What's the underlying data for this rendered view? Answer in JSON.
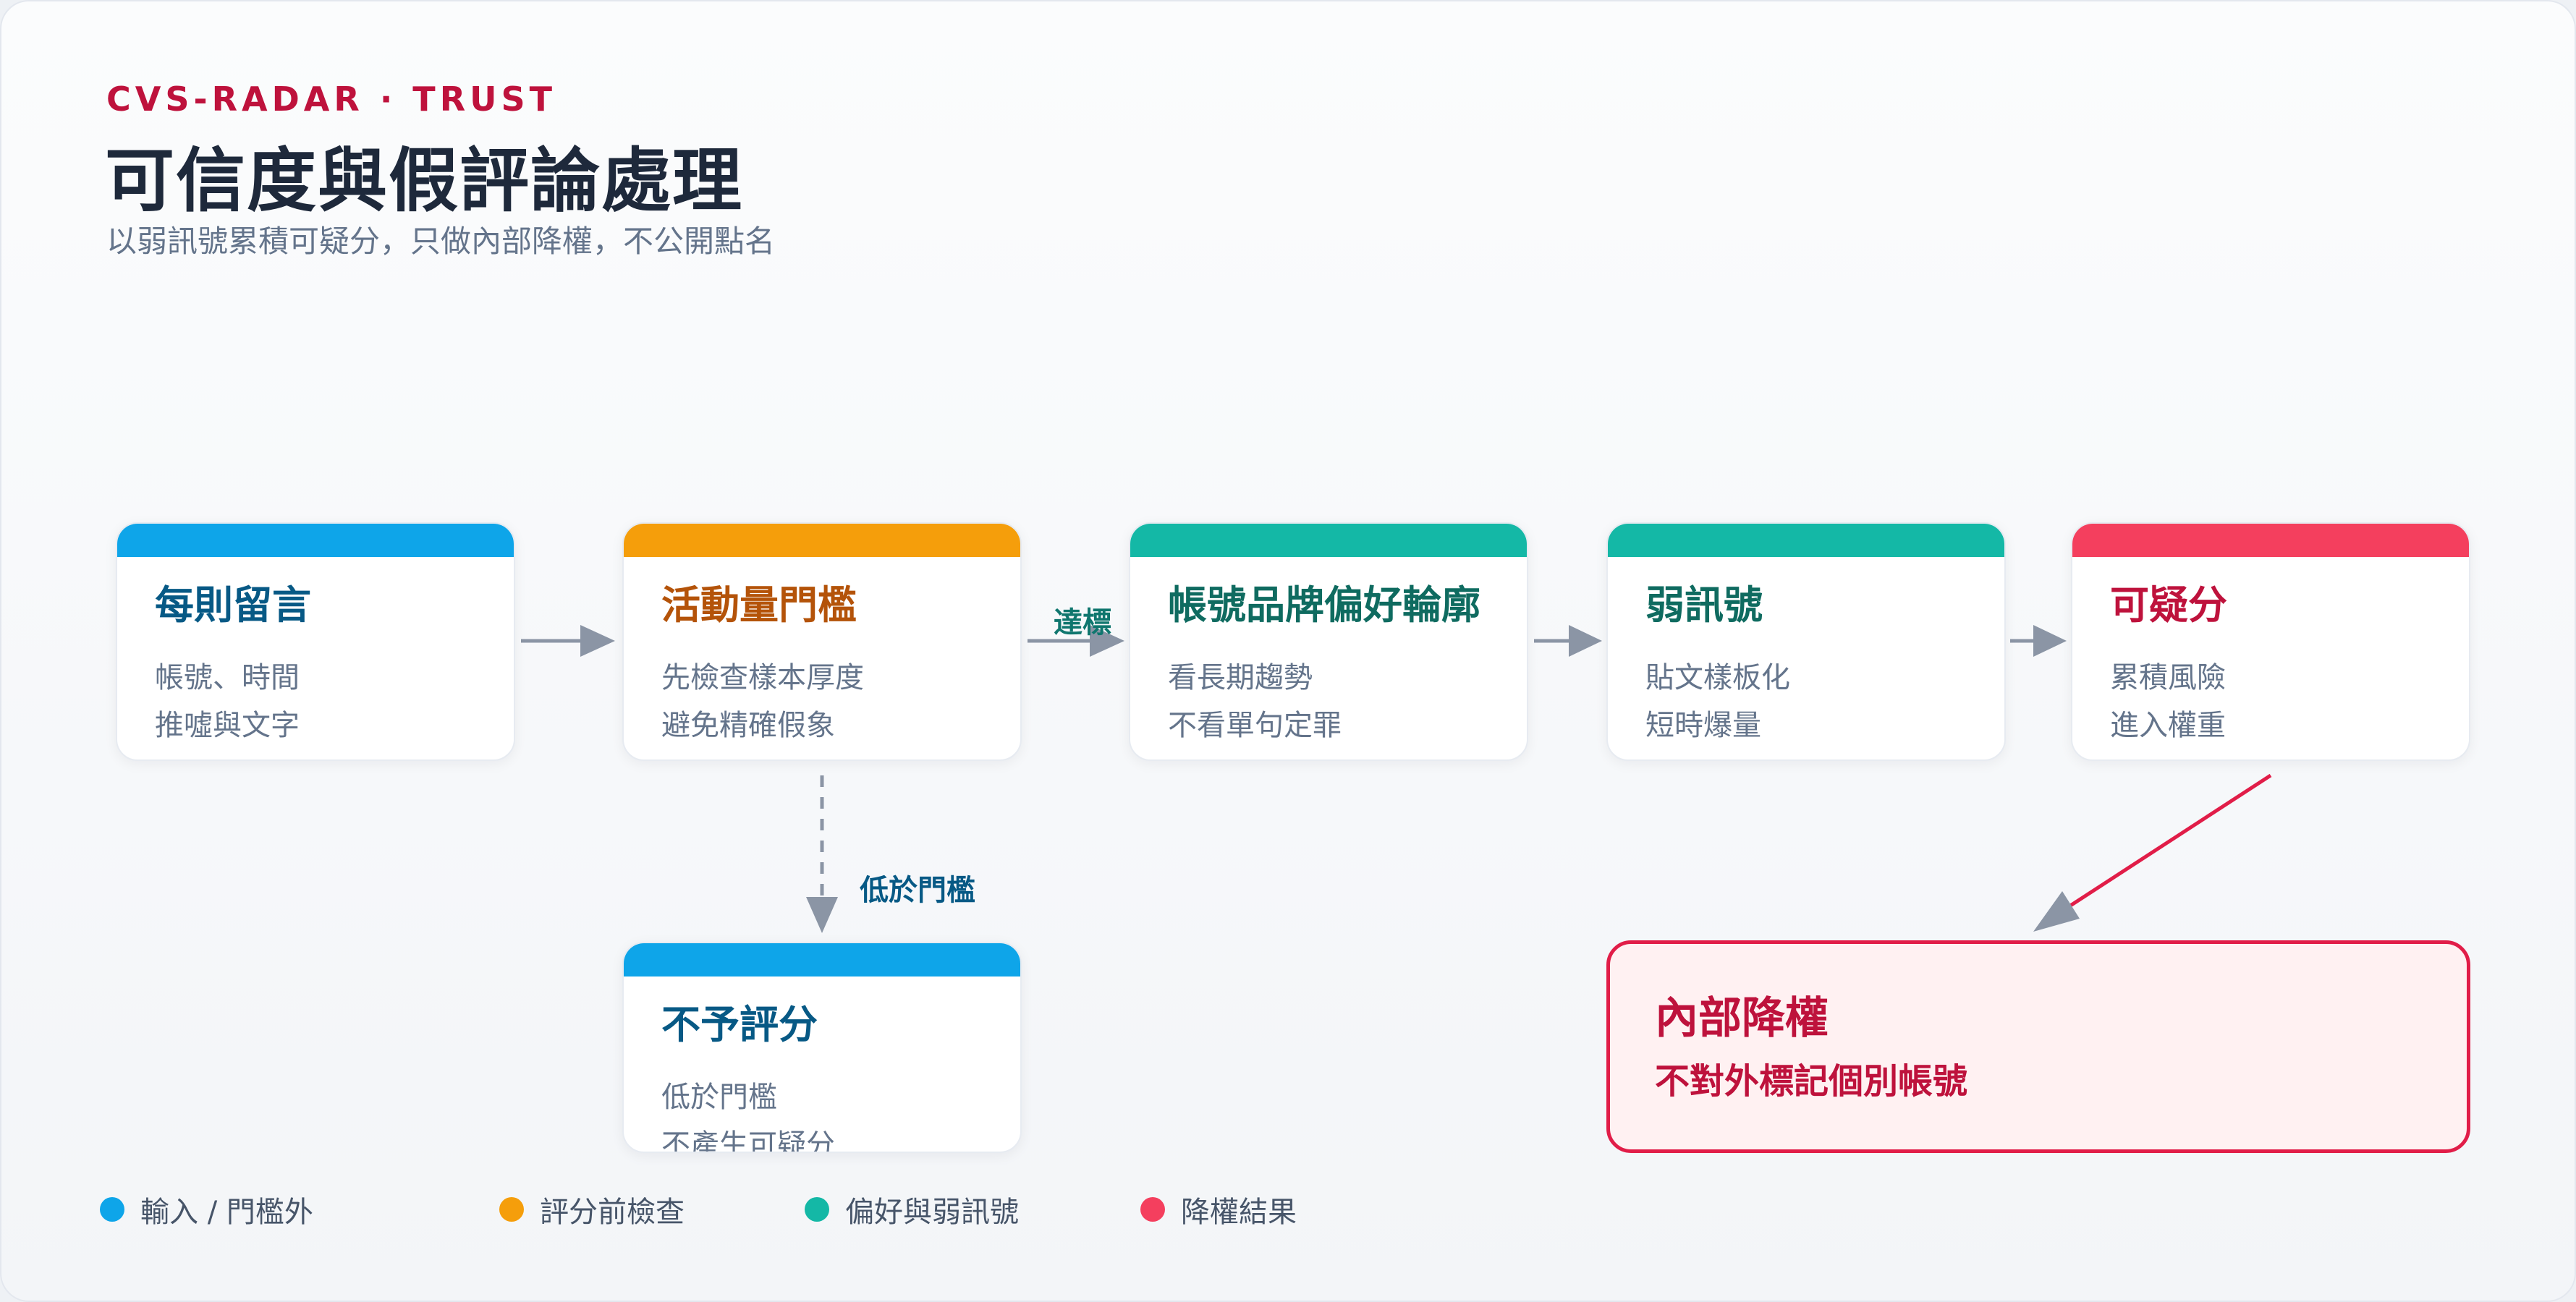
{
  "header": {
    "eyebrow": "CVS-RADAR · TRUST",
    "title": "可信度與假評論處理",
    "subtitle": "以弱訊號累積可疑分，只做內部降權，不公開點名"
  },
  "nodes": {
    "comment": {
      "title": "每則留言",
      "line1": "帳號、時間",
      "line2": "推噓與文字"
    },
    "threshold": {
      "title": "活動量門檻",
      "line1": "先檢查樣本厚度",
      "line2": "避免精確假象"
    },
    "profile": {
      "title": "帳號品牌偏好輪廓",
      "line1": "看長期趨勢",
      "line2": "不看單句定罪"
    },
    "weak": {
      "title": "弱訊號",
      "line1": "貼文樣板化",
      "line2": "短時爆量"
    },
    "suspicion": {
      "title": "可疑分",
      "line1": "累積風險",
      "line2": "進入權重"
    },
    "noscore": {
      "title": "不予評分",
      "line1": "低於門檻",
      "line2": "不產生可疑分"
    },
    "downrank": {
      "title": "內部降權",
      "subtitle": "不對外標記個別帳號"
    }
  },
  "edges": {
    "pass_label": "達標",
    "below_label": "低於門檻"
  },
  "legend": [
    {
      "label": "輸入 / 門檻外",
      "color": "#0ea5e9"
    },
    {
      "label": "評分前檢查",
      "color": "#f59e0b"
    },
    {
      "label": "偏好與弱訊號",
      "color": "#14b8a6"
    },
    {
      "label": "降權結果",
      "color": "#f43f5e"
    }
  ],
  "colors": {
    "arrow": "#8b95a5",
    "risk_arrow": "#e11d48"
  }
}
